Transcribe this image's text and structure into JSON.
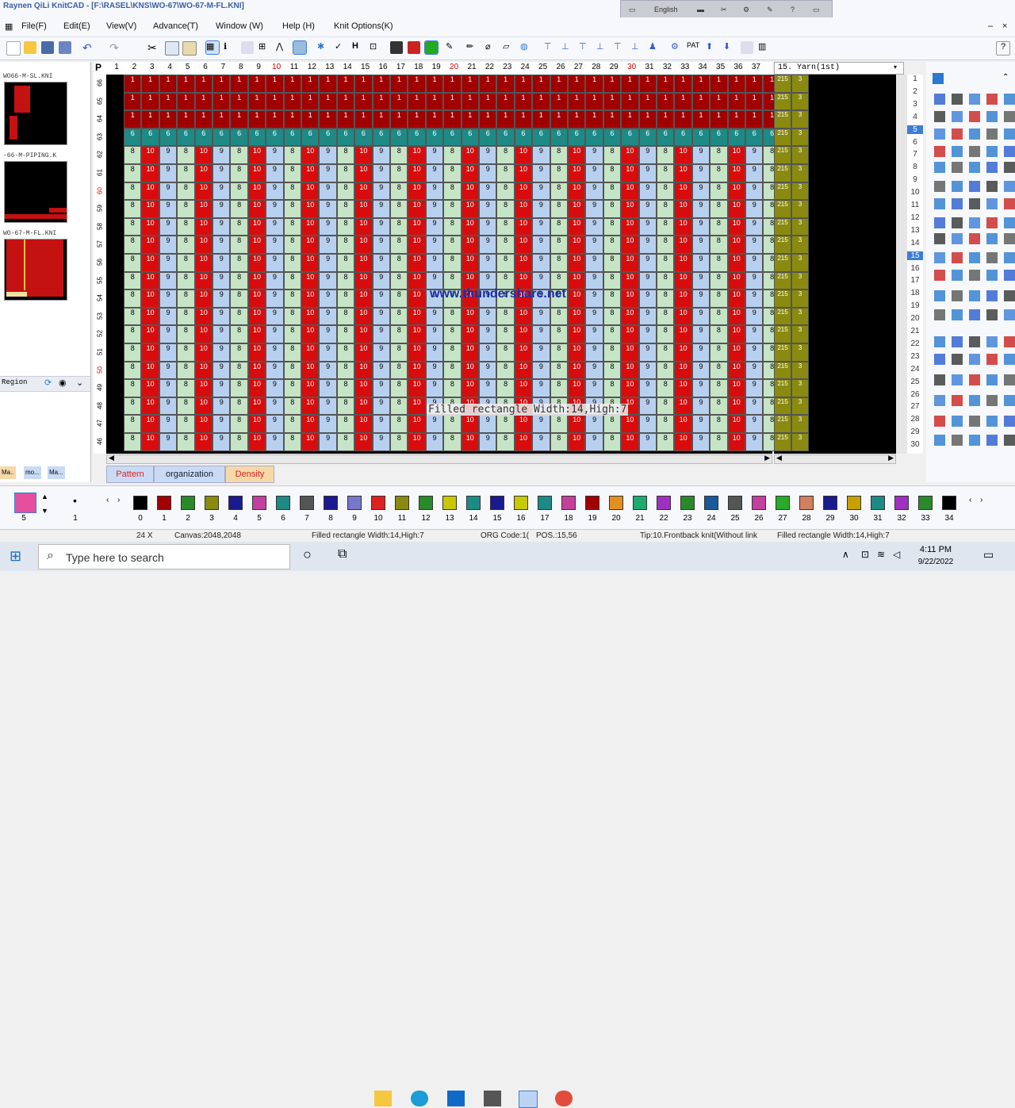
{
  "window": {
    "title": "Raynen QiLi KnitCAD - [F:\\RASEL\\KNS\\WO-67\\WO-67-M-FL.KNI]"
  },
  "language_bar": {
    "language": "English"
  },
  "menu": [
    "File(F)",
    "Edit(E)",
    "View(V)",
    "Advance(T)",
    "Window (W)",
    "Help (H)",
    "Knit Options(K)"
  ],
  "toolbar": {
    "pat_label": "PAT"
  },
  "left_panel": {
    "thumbs": [
      "WO66-M-SL.KNI",
      "-66-M-PIPING.K",
      "WO-67-M-FL.KNI"
    ],
    "region_label": "Region",
    "tabs": [
      "Ma..",
      "mo...",
      "Ma..."
    ]
  },
  "grid": {
    "p_label": "P",
    "columns": [
      "1",
      "2",
      "3",
      "4",
      "5",
      "6",
      "7",
      "8",
      "9",
      "10",
      "11",
      "12",
      "13",
      "14",
      "15",
      "16",
      "17",
      "18",
      "19",
      "20",
      "21",
      "22",
      "23",
      "24",
      "25",
      "26",
      "27",
      "28",
      "29",
      "30",
      "31",
      "32",
      "33",
      "34",
      "35",
      "36",
      "37"
    ],
    "rows": [
      "66",
      "65",
      "64",
      "63",
      "62",
      "61",
      "60",
      "59",
      "58",
      "57",
      "56",
      "55",
      "54",
      "53",
      "52",
      "51",
      "50",
      "49",
      "48",
      "47",
      "46"
    ],
    "top_rows_value": "1",
    "teal_row_value": "6",
    "pattern": [
      "8",
      "10",
      "9",
      "8",
      "10",
      "9",
      "8",
      "10",
      "9",
      "8",
      "10",
      "9",
      "8",
      "10",
      "9",
      "8",
      "10",
      "9",
      "8",
      "10",
      "9",
      "8",
      "10",
      "9",
      "8",
      "10",
      "9",
      "8",
      "10",
      "9",
      "8",
      "10",
      "9",
      "8",
      "10",
      "9",
      "8"
    ]
  },
  "bottom_tabs": [
    "Pattern",
    "organization",
    "Density"
  ],
  "yarn": {
    "header": "15. Yarn(1st)",
    "cells": [
      "215",
      "3"
    ],
    "row_numbers": [
      "1",
      "2",
      "3",
      "4",
      "5",
      "6",
      "7",
      "8",
      "9",
      "10",
      "11",
      "12",
      "13",
      "14",
      "15",
      "16",
      "17",
      "18",
      "19",
      "20",
      "21",
      "22",
      "23",
      "24",
      "25",
      "26",
      "27",
      "28",
      "29",
      "30"
    ]
  },
  "overlays": {
    "watermark": "www.thundershare.net",
    "tip": "Filled rectangle  Width:14,High:7"
  },
  "stitch_bar": {
    "current_left": "5",
    "current_mid": "1",
    "numbers": [
      "0",
      "1",
      "2",
      "3",
      "4",
      "5",
      "6",
      "7",
      "8",
      "9",
      "10",
      "11",
      "12",
      "13",
      "14",
      "15",
      "16",
      "17",
      "18",
      "19",
      "20",
      "21",
      "22",
      "23",
      "24",
      "25",
      "26",
      "27",
      "28",
      "29",
      "30",
      "31",
      "32",
      "33",
      "34"
    ]
  },
  "status": {
    "zoom": "24 X",
    "canvas": "Canvas:2048,2048",
    "shape": "Filled rectangle  Width:14,High:7",
    "org": "ORG Code:1(",
    "pos": "POS.:15,56",
    "tip": "Tip:10.Frontback knit(Without link",
    "shape2": "Filled rectangle  Width:14,High:7"
  },
  "taskbar": {
    "search_placeholder": "Type here to search",
    "time": "4:11 PM",
    "date": "9/22/2022"
  },
  "colors": {
    "red": "#d80c0c",
    "blue": "#b8d0f0",
    "green": "#c6e4c6",
    "dark_red": "#a00000",
    "teal": "#1e8a85",
    "olive": "#8a8a10"
  }
}
